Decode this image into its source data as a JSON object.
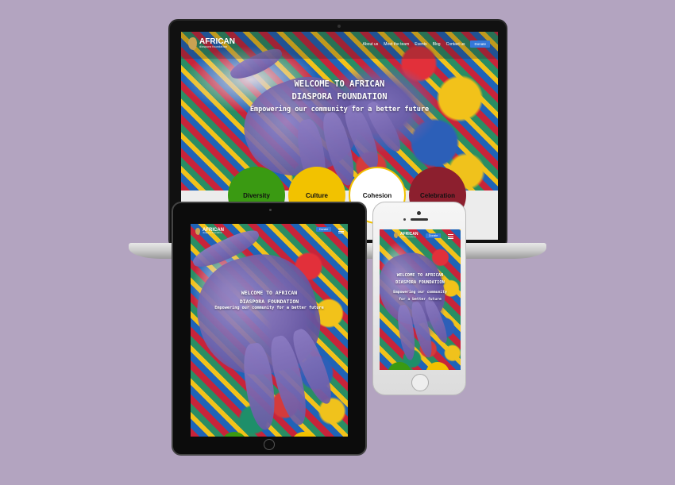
{
  "brand": {
    "name": "AFRICAN",
    "tagline": "diaspora foundation"
  },
  "nav": {
    "items": [
      "About us",
      "Meet the team",
      "Events",
      "Blog",
      "Contact us"
    ],
    "donate": "Donate"
  },
  "hero": {
    "title_line1": "WELCOME TO AFRICAN",
    "title_line2": "DIASPORA FOUNDATION",
    "subtitle": "Empowering our community for a better future",
    "subtitle_line1": "Empowering our community",
    "subtitle_line2": "for a better future"
  },
  "circles": [
    {
      "label": "Diversity",
      "color": "#3a9a12"
    },
    {
      "label": "Culture",
      "color": "#f2c200"
    },
    {
      "label": "Cohesion",
      "color": "#ffffff"
    },
    {
      "label": "Celebration",
      "color": "#8c1f2e"
    }
  ],
  "colors": {
    "background": "#b3a4c0",
    "donate": "#3478d9"
  },
  "icons": [
    "africa-logo-icon",
    "hamburger-menu-icon"
  ]
}
